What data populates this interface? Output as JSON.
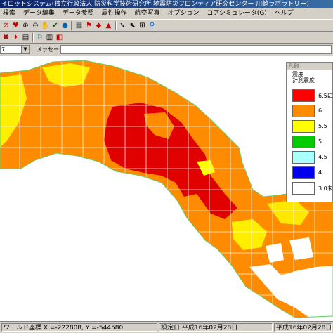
{
  "window": {
    "title": "イロットシステム(独立行政法人 防災科学技術研究所 地震防災フロンティア研究センター 川崎ラボラトリー)"
  },
  "menu": {
    "items": [
      "検索",
      "データ編集",
      "データ参照",
      "属性操作",
      "航空写真",
      "オプション",
      "コアシミュレータ(G)",
      "ヘルプ"
    ]
  },
  "toolbar": {
    "combo_value": "7",
    "message_label": "メッセージ",
    "message_value": ""
  },
  "legend": {
    "header": "凡例",
    "title": "震度",
    "subtitle": "計測震度",
    "items": [
      {
        "label": "6.5に",
        "color": "#ff0000"
      },
      {
        "label": "6",
        "color": "#ff8c00"
      },
      {
        "label": "5.5",
        "color": "#ffff00"
      },
      {
        "label": "5",
        "color": "#00cc00"
      },
      {
        "label": "4.5",
        "color": "#aaffff"
      },
      {
        "label": "4",
        "color": "#0000ee"
      },
      {
        "label": "3.0未",
        "color": "#ffffff"
      }
    ]
  },
  "status": {
    "coords": "ワールド座標  X =-222808, Y =-544580",
    "set_date": "設定日  平成16年02月28日",
    "date": "平成16年02月28日"
  },
  "colors": {
    "red": "#e00000",
    "orange": "#ff8c00",
    "yellow": "#ffff00",
    "grid": "#ffffff"
  }
}
